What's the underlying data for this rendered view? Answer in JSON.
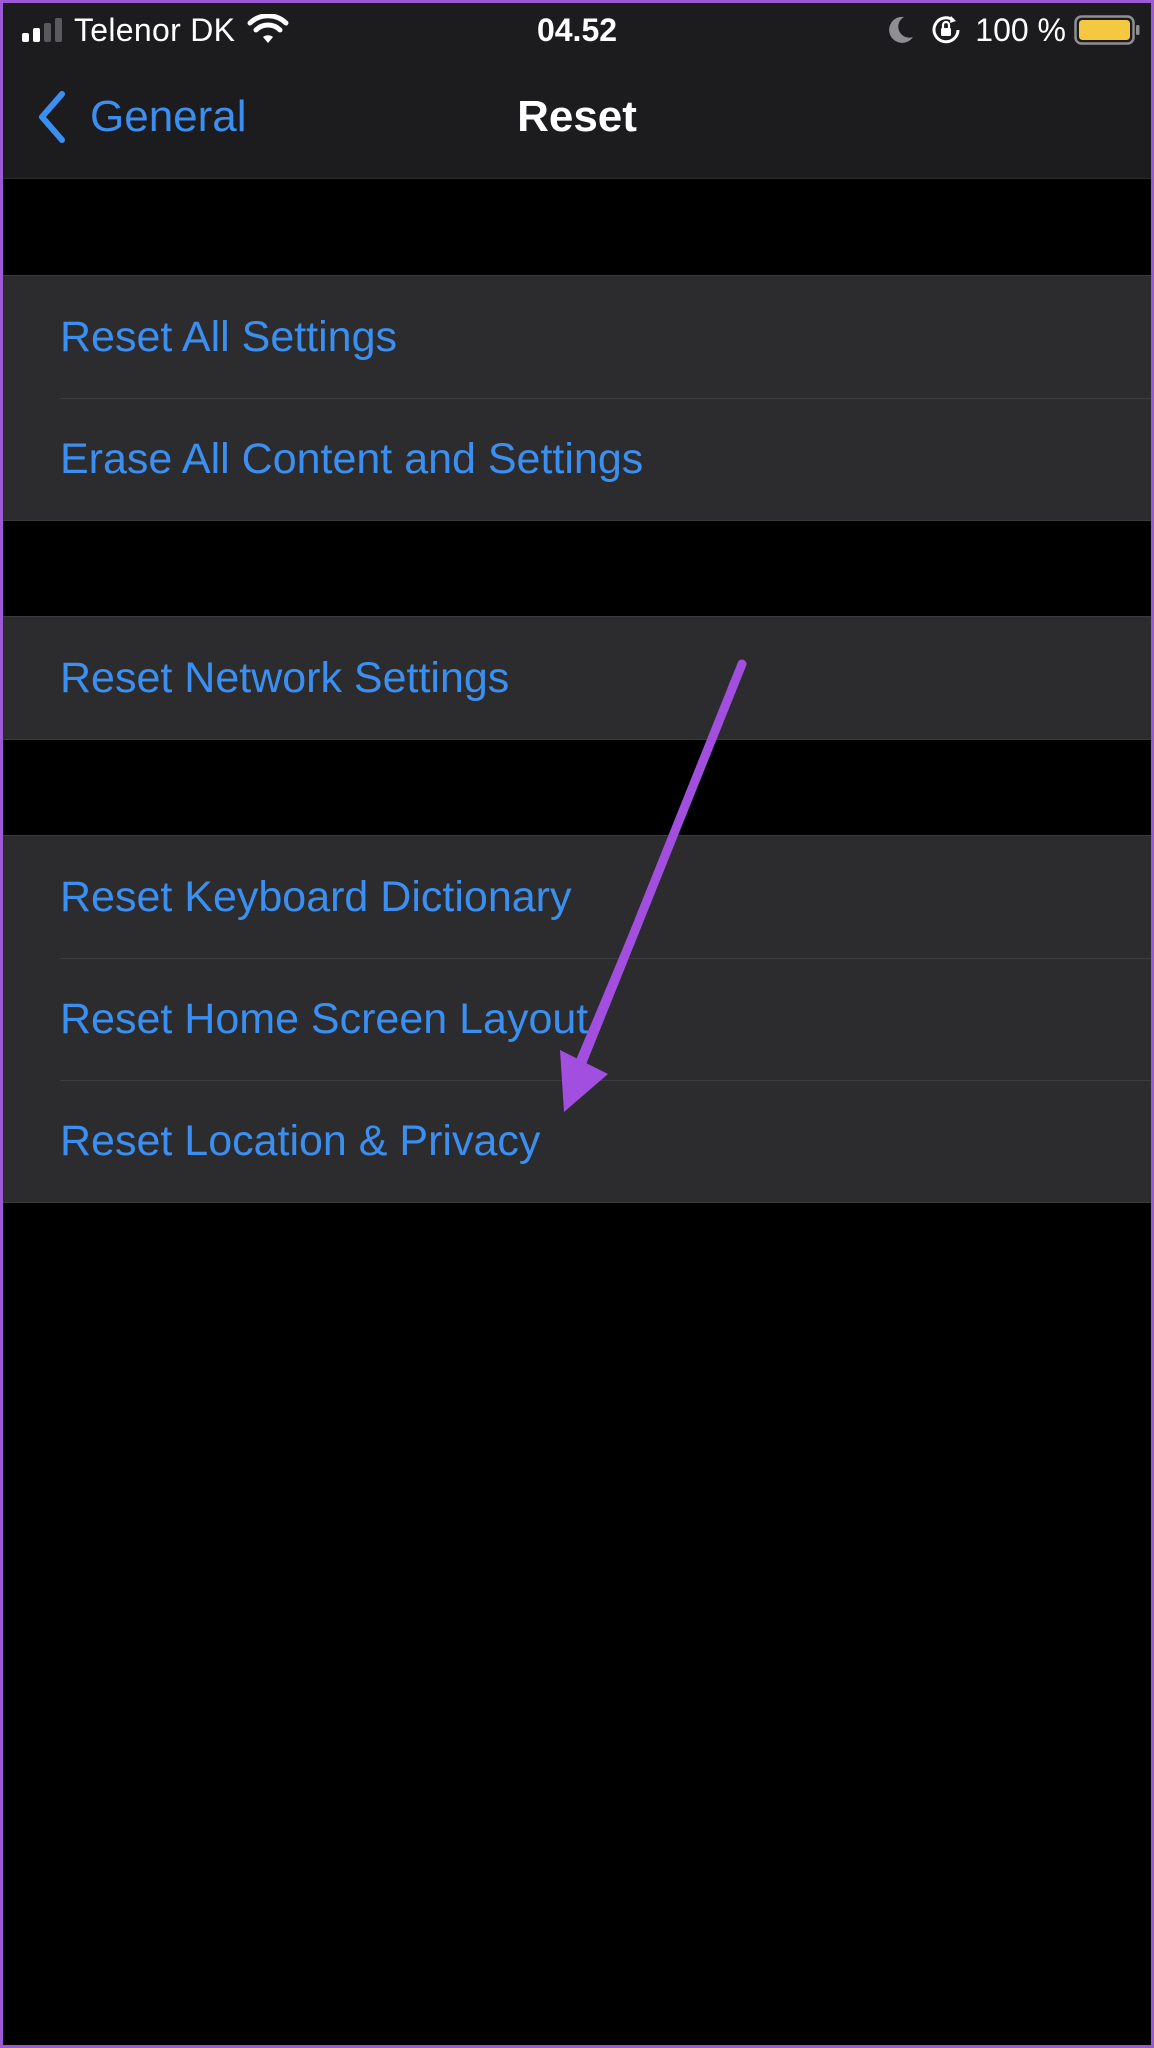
{
  "status_bar": {
    "carrier": "Telenor DK",
    "time": "04.52",
    "battery_percent": "100 %",
    "signal_bars_active": 2,
    "signal_bars_total": 4,
    "battery_color": "#f5c842",
    "icons": [
      "signal-icon",
      "wifi-icon",
      "moon-icon",
      "rotation-lock-icon",
      "battery-icon"
    ]
  },
  "nav": {
    "back_label": "General",
    "title": "Reset"
  },
  "groups": [
    {
      "items": [
        {
          "label": "Reset All Settings"
        },
        {
          "label": "Erase All Content and Settings"
        }
      ]
    },
    {
      "items": [
        {
          "label": "Reset Network Settings"
        }
      ]
    },
    {
      "items": [
        {
          "label": "Reset Keyboard Dictionary"
        },
        {
          "label": "Reset Home Screen Layout"
        },
        {
          "label": "Reset Location & Privacy"
        }
      ]
    }
  ],
  "colors": {
    "accent": "#3b8ff0",
    "background": "#000000",
    "cell_background": "#2c2c2e",
    "annotation_arrow": "#a24fe0"
  }
}
